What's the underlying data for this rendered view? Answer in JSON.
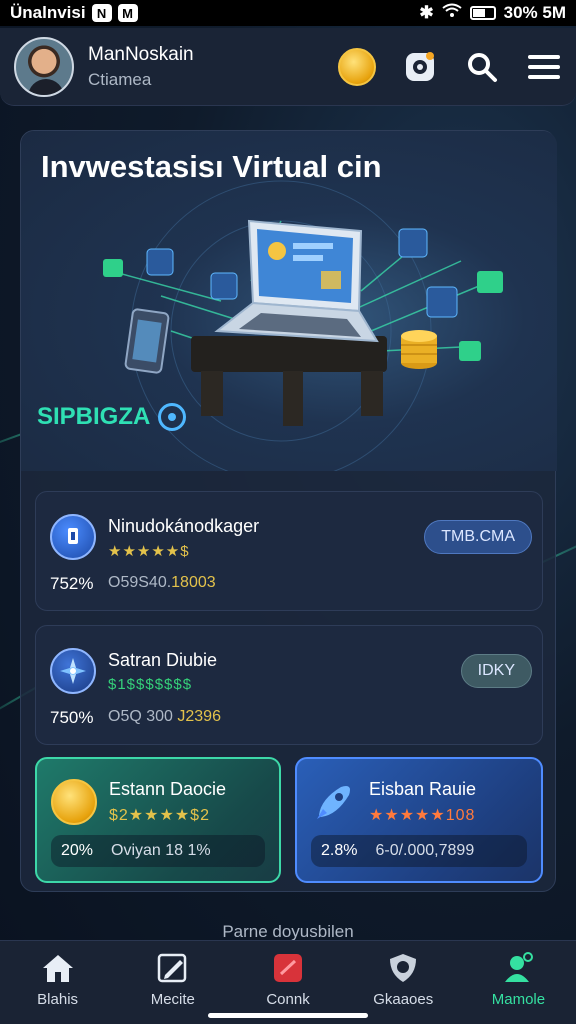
{
  "status_bar": {
    "carrier": "Ünalnvisi",
    "badges": [
      "N",
      "M"
    ],
    "right_text": "30% 5M"
  },
  "header": {
    "user_name": "ManNoskain",
    "user_subtitle": "Ctiamea",
    "icons": [
      "coin-icon",
      "gear-icon",
      "search-icon",
      "menu-icon"
    ]
  },
  "hero": {
    "title": "Invwestasisı Virtual cin",
    "tag": "SIPBIGZA"
  },
  "list_cards": [
    {
      "title": "Ninudokánodkager",
      "rating": "★★★★★$",
      "percent": "752%",
      "value_prefix": "O59S40.",
      "value_highlight": "18003",
      "button": "TMB.CMA",
      "button_color": "#2d4f8c",
      "rating_color": "#e3c24b"
    },
    {
      "title": "Satran Diubie",
      "rating": "$1$$$$$$$",
      "percent": "750%",
      "value_prefix": "O5Q 300 ",
      "value_highlight": "J2396",
      "button": "IDKY",
      "button_color": "#3e5a63",
      "rating_color": "#35d07a"
    }
  ],
  "bottom_cards": [
    {
      "title": "Estann Daocie",
      "rating": "$2★★★★$2",
      "percent": "20%",
      "value": "Oviyan 18 1%",
      "rating_color": "#e3c24b"
    },
    {
      "title": "Eisban Rauie",
      "rating": "★★★★★108",
      "percent": "2.8%",
      "value": "6-0/.000,7899",
      "rating_color": "#ff7a3d"
    }
  ],
  "footnote": "Parne doyusbilen",
  "bottom_nav": [
    {
      "label": "Blahis",
      "icon": "home-icon",
      "active": false
    },
    {
      "label": "Mecite",
      "icon": "edit-icon",
      "active": false
    },
    {
      "label": "Connk",
      "icon": "tag-icon",
      "active": false
    },
    {
      "label": "Gkaaoes",
      "icon": "shield-icon",
      "active": false
    },
    {
      "label": "Mamole",
      "icon": "profile-icon",
      "active": true
    }
  ],
  "colors": {
    "accent_green": "#35e0a1",
    "accent_blue": "#4f8cff",
    "gold": "#f5c542"
  }
}
